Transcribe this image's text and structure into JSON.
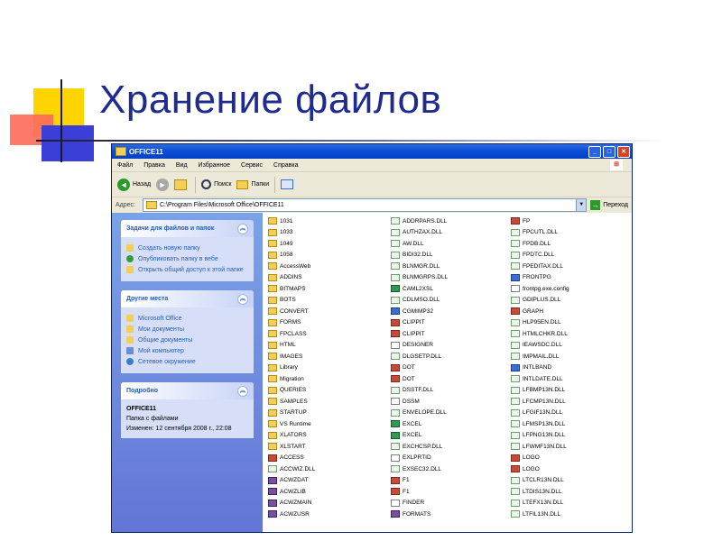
{
  "slide": {
    "title": "Хранение файлов"
  },
  "window": {
    "title": "OFFICE11",
    "controls": {
      "minimize": "_",
      "maximize": "□",
      "close": "✕"
    },
    "logo": "⊞"
  },
  "menu": [
    "Файл",
    "Правка",
    "Вид",
    "Избранное",
    "Сервис",
    "Справка"
  ],
  "toolbar": {
    "back": "Назад",
    "back_glyph": "◄",
    "forward_glyph": "►",
    "search": "Поиск",
    "folders": "Папки"
  },
  "address": {
    "label": "Адрес:",
    "value": "C:\\Program Files\\Microsoft Office\\OFFICE11",
    "go": "Переход",
    "go_glyph": "→"
  },
  "sidebar": {
    "chevron": "︽",
    "tasks": {
      "title": "Задачи для файлов и папок",
      "items": [
        "Создать новую папку",
        "Опубликовать папку в вебе",
        "Открыть общий доступ к этой папке"
      ]
    },
    "places": {
      "title": "Другие места",
      "items": [
        "Microsoft Office",
        "Мои документы",
        "Общие документы",
        "Мой компьютер",
        "Сетевое окружение"
      ]
    },
    "details": {
      "title": "Подробно",
      "name": "OFFICE11",
      "type": "Папка с файлами",
      "modified": "Изменен: 12 сентября 2008 г., 22:08"
    }
  },
  "files": {
    "col1": [
      {
        "name": "1031",
        "kind": "folder"
      },
      {
        "name": "1033",
        "kind": "folder"
      },
      {
        "name": "1049",
        "kind": "folder"
      },
      {
        "name": "1058",
        "kind": "folder"
      },
      {
        "name": "AccessWeb",
        "kind": "folder"
      },
      {
        "name": "ADDINS",
        "kind": "folder"
      },
      {
        "name": "BITMAPS",
        "kind": "folder"
      },
      {
        "name": "BOTS",
        "kind": "folder"
      },
      {
        "name": "CONVERT",
        "kind": "folder"
      },
      {
        "name": "FORMS",
        "kind": "folder"
      },
      {
        "name": "FPCLASS",
        "kind": "folder"
      },
      {
        "name": "HTML",
        "kind": "folder"
      },
      {
        "name": "IMAGES",
        "kind": "folder"
      },
      {
        "name": "Library",
        "kind": "folder"
      },
      {
        "name": "Migration",
        "kind": "folder"
      },
      {
        "name": "QUERIES",
        "kind": "folder"
      },
      {
        "name": "SAMPLES",
        "kind": "folder"
      },
      {
        "name": "STARTUP",
        "kind": "folder"
      },
      {
        "name": "VS Runtime",
        "kind": "folder"
      },
      {
        "name": "XLATORS",
        "kind": "folder"
      },
      {
        "name": "XLSTART",
        "kind": "folder"
      },
      {
        "name": "ACCESS",
        "kind": "img"
      },
      {
        "name": "ACCWIZ.DLL",
        "kind": "dll"
      },
      {
        "name": "ACWZDAT",
        "kind": "app"
      },
      {
        "name": "ACWZLIB",
        "kind": "app"
      },
      {
        "name": "ACWZMAIN",
        "kind": "app"
      },
      {
        "name": "ACWZUSR",
        "kind": "app"
      }
    ],
    "col2": [
      {
        "name": "ADDRPARS.DLL",
        "kind": "dll"
      },
      {
        "name": "AUTHZAX.DLL",
        "kind": "dll"
      },
      {
        "name": "AW.DLL",
        "kind": "dll"
      },
      {
        "name": "BIDI32.DLL",
        "kind": "dll"
      },
      {
        "name": "BLNMGR.DLL",
        "kind": "dll"
      },
      {
        "name": "BLNMGRPS.DLL",
        "kind": "dll"
      },
      {
        "name": "CAML2XSL",
        "kind": "exe"
      },
      {
        "name": "CDLMSO.DLL",
        "kind": "dll"
      },
      {
        "name": "CGMIMP32",
        "kind": "blue"
      },
      {
        "name": "CLIPPIT",
        "kind": "img"
      },
      {
        "name": "CLIPPIT",
        "kind": "img"
      },
      {
        "name": "DESIGNER",
        "kind": "doc"
      },
      {
        "name": "DLGSETP.DLL",
        "kind": "dll"
      },
      {
        "name": "DOT",
        "kind": "img"
      },
      {
        "name": "DOT",
        "kind": "img"
      },
      {
        "name": "DSSTF.DLL",
        "kind": "dll"
      },
      {
        "name": "DSSM",
        "kind": "doc"
      },
      {
        "name": "ENVELOPE.DLL",
        "kind": "dll"
      },
      {
        "name": "EXCEL",
        "kind": "exe"
      },
      {
        "name": "EXCEL",
        "kind": "exe"
      },
      {
        "name": "EXCHCSP.DLL",
        "kind": "dll"
      },
      {
        "name": "EXLPRTID",
        "kind": "doc"
      },
      {
        "name": "EXSEC32.DLL",
        "kind": "dll"
      },
      {
        "name": "F1",
        "kind": "img"
      },
      {
        "name": "F1",
        "kind": "img"
      },
      {
        "name": "FINDER",
        "kind": "doc"
      },
      {
        "name": "FORMATS",
        "kind": "app"
      }
    ],
    "col3": [
      {
        "name": "FP",
        "kind": "img"
      },
      {
        "name": "FPCUTL.DLL",
        "kind": "dll"
      },
      {
        "name": "FPDB.DLL",
        "kind": "dll"
      },
      {
        "name": "FPDTC.DLL",
        "kind": "dll"
      },
      {
        "name": "FPEDITAX.DLL",
        "kind": "dll"
      },
      {
        "name": "FRONTPG",
        "kind": "blue"
      },
      {
        "name": "frontpg.exe.config",
        "kind": "doc"
      },
      {
        "name": "GDIPLUS.DLL",
        "kind": "dll"
      },
      {
        "name": "GRAPH",
        "kind": "img"
      },
      {
        "name": "HLP95EN.DLL",
        "kind": "dll"
      },
      {
        "name": "HTMLCHKR.DLL",
        "kind": "dll"
      },
      {
        "name": "IEAWSDC.DLL",
        "kind": "dll"
      },
      {
        "name": "IMPMAIL.DLL",
        "kind": "dll"
      },
      {
        "name": "INTLBAND",
        "kind": "blue"
      },
      {
        "name": "INTLDATE.DLL",
        "kind": "dll"
      },
      {
        "name": "LFBMP13N.DLL",
        "kind": "dll"
      },
      {
        "name": "LFCMP13N.DLL",
        "kind": "dll"
      },
      {
        "name": "LFGIF13N.DLL",
        "kind": "dll"
      },
      {
        "name": "LFMSP13N.DLL",
        "kind": "dll"
      },
      {
        "name": "LFPNG13N.DLL",
        "kind": "dll"
      },
      {
        "name": "LFWMF13N.DLL",
        "kind": "dll"
      },
      {
        "name": "LOGO",
        "kind": "img"
      },
      {
        "name": "LOGO",
        "kind": "img"
      },
      {
        "name": "LTCLR13N.DLL",
        "kind": "dll"
      },
      {
        "name": "LTDIS13N.DLL",
        "kind": "dll"
      },
      {
        "name": "LTEFX13N.DLL",
        "kind": "dll"
      },
      {
        "name": "LTFIL13N.DLL",
        "kind": "dll"
      }
    ]
  }
}
